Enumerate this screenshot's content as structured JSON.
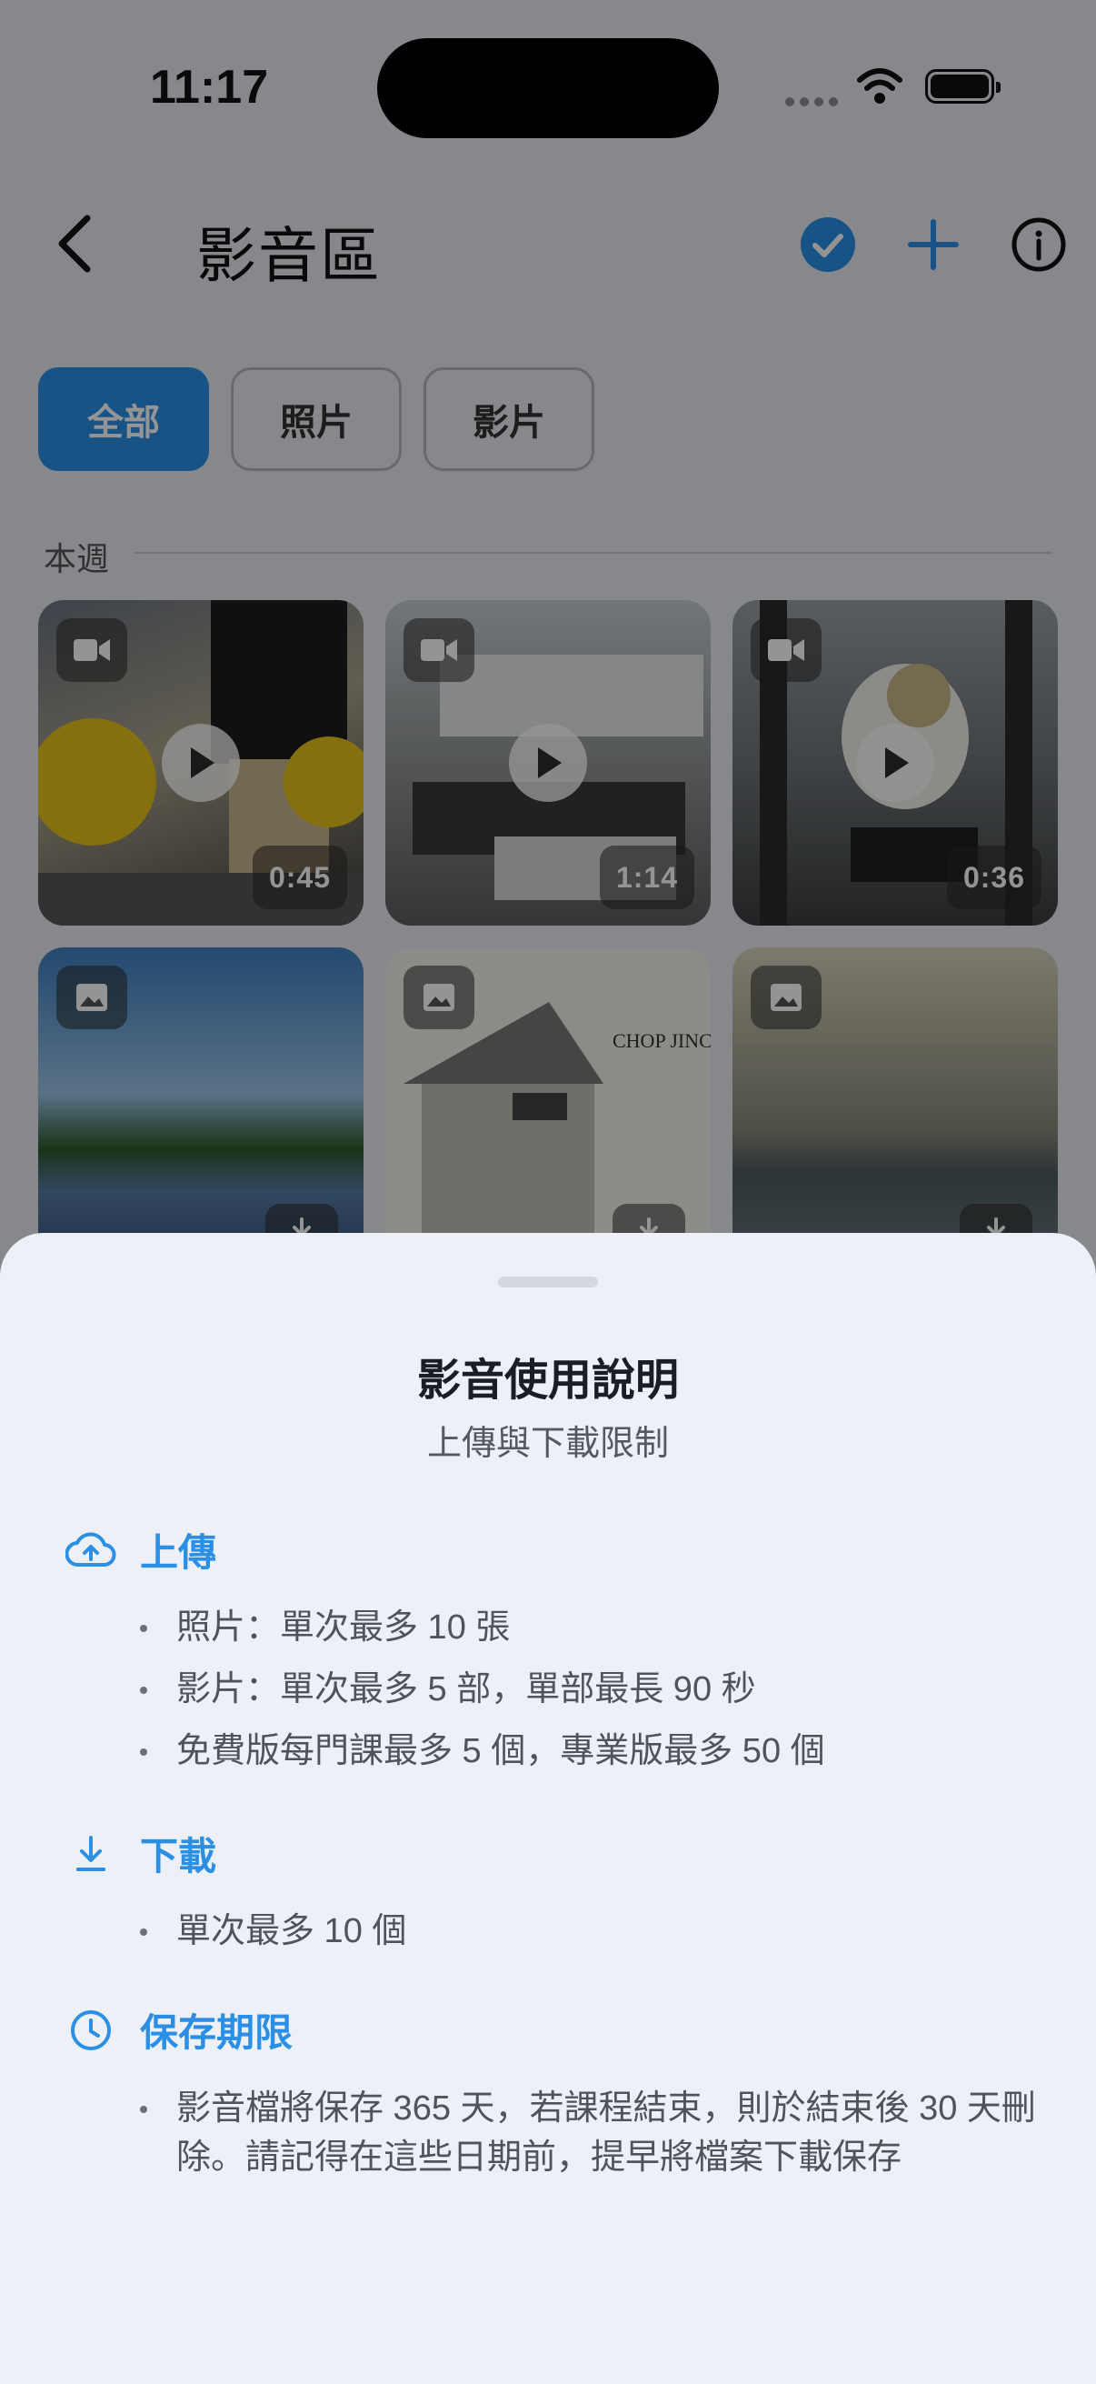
{
  "status_bar": {
    "time": "11:17"
  },
  "header": {
    "title": "影音區",
    "icons": [
      "chevron-left-icon",
      "check-circle-icon",
      "plus-icon",
      "info-icon"
    ],
    "accent_color": "#2a8fe5"
  },
  "filters": [
    {
      "label": "全部",
      "selected": true
    },
    {
      "label": "照片",
      "selected": false
    },
    {
      "label": "影片",
      "selected": false
    }
  ],
  "section": {
    "label": "本週"
  },
  "media": [
    {
      "type": "video",
      "duration": "0:45"
    },
    {
      "type": "video",
      "duration": "1:14"
    },
    {
      "type": "video",
      "duration": "0:36"
    },
    {
      "type": "photo"
    },
    {
      "type": "photo"
    },
    {
      "type": "photo"
    }
  ],
  "sheet": {
    "title": "影音使用說明",
    "subtitle": "上傳與下載限制",
    "sections": [
      {
        "title": "上傳",
        "icon": "cloud-upload-icon",
        "items": [
          "照片：單次最多 10 張",
          "影片：單次最多 5 部，單部最長 90 秒",
          "免費版每門課最多 5 個，專業版最多 50 個"
        ]
      },
      {
        "title": "下載",
        "icon": "download-icon",
        "items": [
          "單次最多 10 個"
        ]
      },
      {
        "title": "保存期限",
        "icon": "clock-icon",
        "items": [
          "影音檔將保存 365 天，若課程結束，則於結束後 30 天刪除。請記得在這些日期前，提早將檔案下載保存"
        ]
      }
    ]
  }
}
